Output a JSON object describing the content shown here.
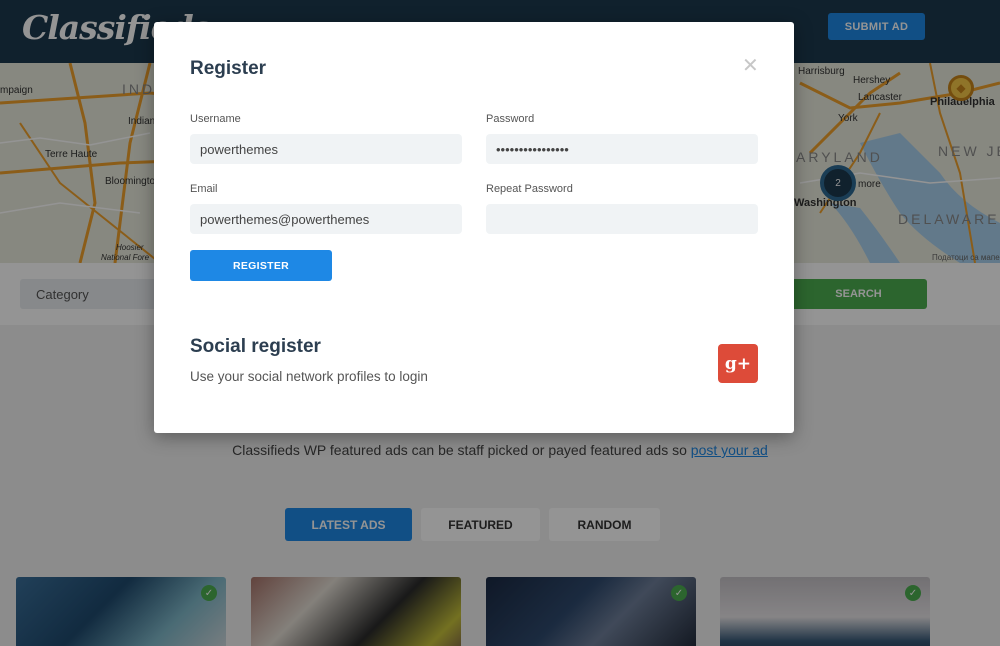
{
  "header": {
    "logo": "Classifieds",
    "submit_label": "SUBMIT AD"
  },
  "map": {
    "labels": {
      "ind": "INDI",
      "indiana": "Indiana",
      "campaign": "mpaign",
      "terre_haute": "Terre Haute",
      "bloomington": "Bloomington",
      "hoosier": "Hoosier",
      "national_fore": "National Fore",
      "harrisburg": "Harrisburg",
      "hershey": "Hershey",
      "lancaster": "Lancaster",
      "york": "York",
      "philadelphia": "Philadelphia",
      "maryland": "ARYLAND",
      "new_jersey": "NEW JE",
      "baltimore": "more",
      "washington": "Washington",
      "delaware": "DELAWARE",
      "attribution": "Податоци са мапе ©"
    },
    "cluster_count": "2",
    "pin_icon": "diamond-icon",
    "colors": {
      "highway": "#f0a02b",
      "road": "#ffffff",
      "water": "#a9d0ee"
    }
  },
  "search": {
    "category_placeholder": "Category",
    "button_label": "SEARCH"
  },
  "featured": {
    "text": "Classifieds WP featured ads can be staff picked or payed featured ads so ",
    "link": "post your ad"
  },
  "tabs": [
    {
      "label": "LATEST ADS",
      "active": true
    },
    {
      "label": "FEATURED",
      "active": false
    },
    {
      "label": "RANDOM",
      "active": false
    }
  ],
  "ads": [
    {
      "image": "smartwatch-box-photo",
      "verified": true
    },
    {
      "image": "camera-plant-photo",
      "verified": false
    },
    {
      "image": "perfume-bottle-photo",
      "verified": true
    },
    {
      "image": "wristwatch-photo",
      "verified": true
    }
  ],
  "modal": {
    "title": "Register",
    "close_icon": "close-icon",
    "username_label": "Username",
    "username_value": "powerthemes",
    "password_label": "Password",
    "password_value": "••••••••••••••••",
    "email_label": "Email",
    "email_value": "powerthemes@powerthemes",
    "repeat_password_label": "Repeat Password",
    "repeat_password_value": "",
    "register_label": "REGISTER",
    "social_title": "Social register",
    "social_subtitle": "Use your social network profiles to login",
    "gplus_label": "g+"
  },
  "colors": {
    "accent": "#1e88e5",
    "success": "#4caf50",
    "gplus": "#dd4b39",
    "header_bg": "#1d3a4e"
  }
}
